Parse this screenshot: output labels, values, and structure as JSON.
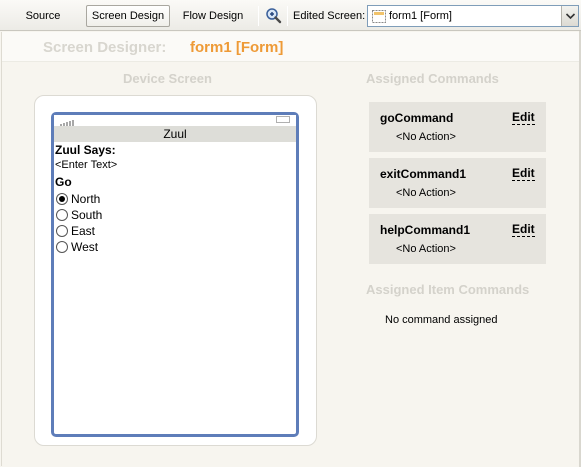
{
  "toolbar": {
    "tabs": [
      {
        "label": "Source",
        "active": false
      },
      {
        "label": "Screen Design",
        "active": true
      },
      {
        "label": "Flow Design",
        "active": false
      }
    ],
    "zoom_icon": "zoom-in-icon",
    "edited_screen_label": "Edited Screen:",
    "edited_screen_value": "form1 [Form]"
  },
  "designer": {
    "title": "Screen Designer:",
    "form_name": "form1 [Form]"
  },
  "device": {
    "heading": "Device Screen",
    "screen_title": "Zuul",
    "items": {
      "says_label": "Zuul Says:",
      "text_field": "<Enter Text>",
      "choice_label": "Go"
    },
    "choices": [
      {
        "label": "North",
        "selected": true
      },
      {
        "label": "South",
        "selected": false
      },
      {
        "label": "East",
        "selected": false
      },
      {
        "label": "West",
        "selected": false
      }
    ]
  },
  "assigned_commands": {
    "heading": "Assigned Commands",
    "commands": [
      {
        "name": "goCommand",
        "edit": "Edit",
        "action": "<No Action>"
      },
      {
        "name": "exitCommand1",
        "edit": "Edit",
        "action": "<No Action>"
      },
      {
        "name": "helpCommand1",
        "edit": "Edit",
        "action": "<No Action>"
      }
    ]
  },
  "assigned_item_commands": {
    "heading": "Assigned Item Commands",
    "empty_text": "No command assigned"
  },
  "colors": {
    "accent_orange": "#ee9a36",
    "heading_gray": "#d4d2cb",
    "device_border": "#5e7db9",
    "card_bg": "#e6e4de"
  }
}
